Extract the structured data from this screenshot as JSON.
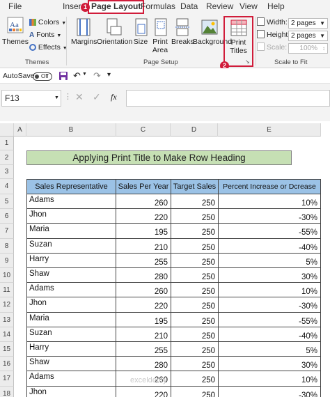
{
  "tabs": [
    {
      "label": "File"
    },
    {
      "label": "Insert"
    },
    {
      "label": "Page Layout"
    },
    {
      "label": "Formulas"
    },
    {
      "label": "Data"
    },
    {
      "label": "Review"
    },
    {
      "label": "View"
    },
    {
      "label": "Help"
    }
  ],
  "steps": {
    "one": "1",
    "two": "2"
  },
  "ribbon": {
    "themes": {
      "button": "Themes",
      "colors": "Colors",
      "fonts": "Fonts",
      "effects": "Effects",
      "group": "Themes"
    },
    "page_setup": {
      "margins": "Margins",
      "orientation": "Orientation",
      "size": "Size",
      "print_area_1": "Print",
      "print_area_2": "Area",
      "breaks": "Breaks",
      "background": "Background",
      "print_titles_1": "Print",
      "print_titles_2": "Titles",
      "group": "Page Setup"
    },
    "scale_to_fit": {
      "width_label": "Width:",
      "width_value": "2 pages",
      "height_label": "Height:",
      "height_value": "2 pages",
      "scale_label": "Scale:",
      "scale_value": "100%",
      "group": "Scale to Fit"
    }
  },
  "qat": {
    "autosave": "AutoSave",
    "toggle": "Off"
  },
  "formula_bar": {
    "name_box": "F13",
    "fx": "fx",
    "value": ""
  },
  "columns": [
    "A",
    "B",
    "C",
    "D",
    "E"
  ],
  "rows": [
    "1",
    "2",
    "3",
    "4",
    "5",
    "6",
    "7",
    "8",
    "9",
    "10",
    "11",
    "12",
    "13",
    "14",
    "15",
    "16",
    "17",
    "18"
  ],
  "sheet": {
    "title": "Applying Print Title to Make Row Heading",
    "headers": [
      "Sales Representative",
      "Sales Per Year",
      "Target Sales",
      "Percent Increase or Dcrease"
    ],
    "records": [
      {
        "name": "Adams",
        "sales": "260",
        "target": "250",
        "pct": "10%"
      },
      {
        "name": "Jhon",
        "sales": "220",
        "target": "250",
        "pct": "-30%"
      },
      {
        "name": "Maria",
        "sales": "195",
        "target": "250",
        "pct": "-55%"
      },
      {
        "name": "Suzan",
        "sales": "210",
        "target": "250",
        "pct": "-40%"
      },
      {
        "name": "Harry",
        "sales": "255",
        "target": "250",
        "pct": "5%"
      },
      {
        "name": "Shaw",
        "sales": "280",
        "target": "250",
        "pct": "30%"
      },
      {
        "name": "Adams",
        "sales": "260",
        "target": "250",
        "pct": "10%"
      },
      {
        "name": "Jhon",
        "sales": "220",
        "target": "250",
        "pct": "-30%"
      },
      {
        "name": "Maria",
        "sales": "195",
        "target": "250",
        "pct": "-55%"
      },
      {
        "name": "Suzan",
        "sales": "210",
        "target": "250",
        "pct": "-40%"
      },
      {
        "name": "Harry",
        "sales": "255",
        "target": "250",
        "pct": "5%"
      },
      {
        "name": "Shaw",
        "sales": "280",
        "target": "250",
        "pct": "30%"
      },
      {
        "name": "Adams",
        "sales": "260",
        "target": "250",
        "pct": "10%"
      },
      {
        "name": "Jhon",
        "sales": "220",
        "target": "250",
        "pct": "-30%"
      }
    ]
  },
  "watermark": "exceldemy",
  "colors": {
    "accent_red": "#d01c3a",
    "title_fill": "#c6e0b4",
    "header_fill": "#9bc2e6"
  }
}
